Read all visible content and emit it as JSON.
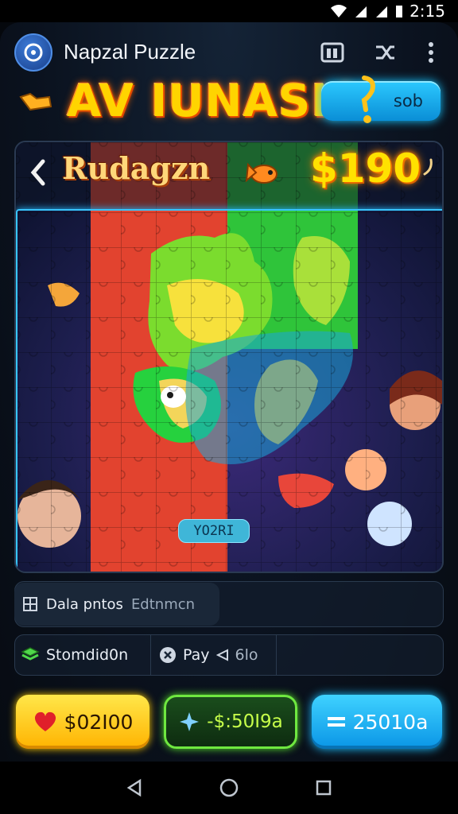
{
  "status_bar": {
    "time": "2:15"
  },
  "app": {
    "title": "Napzal Puzzle",
    "logo_icon": "puzzle-logo-icon"
  },
  "headline": {
    "text": "AV IUNASIA"
  },
  "top_pill": {
    "label": "sob"
  },
  "puzzle": {
    "name": "Rudagzn",
    "prize": "$190",
    "tag": "YO2RI"
  },
  "info": {
    "chip_label": "Dala pntos",
    "chip_value": "Edtnmcn",
    "segment_1": "Stomdid0n",
    "segment_2": "Pay",
    "segment_2_value": "6lo"
  },
  "buttons": {
    "yellow": "$02I00",
    "green": "-$:50I9a",
    "blue": "25010a"
  },
  "colors": {
    "accent_blue": "#2cc9ff",
    "accent_yellow": "#ffd400",
    "accent_green": "#6fe840",
    "heart_red": "#e0202a"
  }
}
